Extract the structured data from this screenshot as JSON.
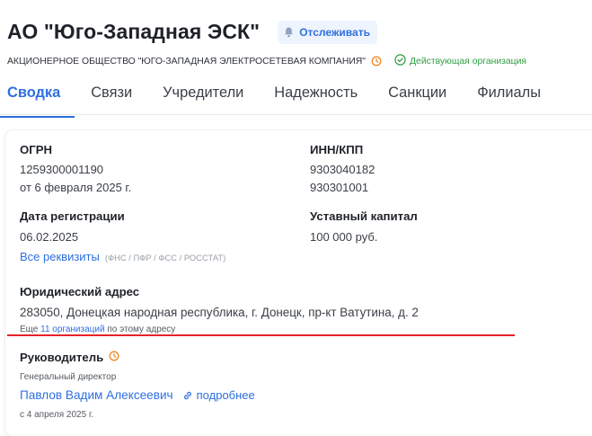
{
  "header": {
    "title": "АО \"Юго-Западная ЭСК\"",
    "follow_label": "Отслеживать",
    "full_name": "АКЦИОНЕРНОЕ ОБЩЕСТВО \"ЮГО-ЗАПАДНАЯ ЭЛЕКТРОСЕТЕВАЯ КОМПАНИЯ\"",
    "status": "Действующая организация"
  },
  "tabs": [
    {
      "label": "Сводка",
      "active": true
    },
    {
      "label": "Связи"
    },
    {
      "label": "Учредители"
    },
    {
      "label": "Надежность"
    },
    {
      "label": "Санкции"
    },
    {
      "label": "Филиалы"
    }
  ],
  "card": {
    "ogrn": {
      "label": "ОГРН",
      "value": "1259300001190",
      "date": "от 6 февраля 2025 г."
    },
    "inn_kpp": {
      "label": "ИНН/КПП",
      "inn": "9303040182",
      "kpp": "930301001"
    },
    "reg_date": {
      "label": "Дата регистрации",
      "value": "06.02.2025"
    },
    "capital": {
      "label": "Уставный капитал",
      "value": "100 000 руб."
    },
    "requisites": {
      "link": "Все реквизиты",
      "hint": "(ФНС / ПФР / ФСС / РОССТАТ)"
    },
    "address": {
      "label": "Юридический адрес",
      "value": "283050, Донецкая народная республика, г. Донецк, пр-кт Ватутина, д. 2",
      "more_prefix": "Еще",
      "more_link": "11 организаций",
      "more_suffix": "по этому адресу"
    },
    "director": {
      "label": "Руководитель",
      "position": "Генеральный директор",
      "name": "Павлов Вадим Алексеевич",
      "more": "подробнее",
      "since": "с 4 апреля 2025 г."
    }
  },
  "colors": {
    "accent": "#2f6fe0",
    "status": "#2f9e41",
    "highlight": "#e5222a",
    "clock": "#f08a24"
  }
}
